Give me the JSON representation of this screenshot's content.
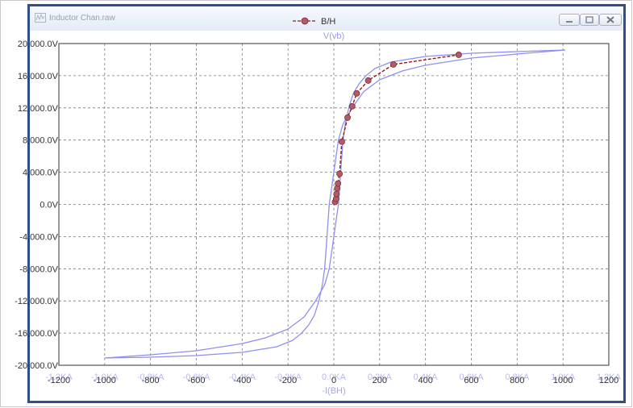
{
  "window": {
    "title": "Inductor Chan.raw",
    "icons": {
      "app": "waveform-app-icon",
      "minimize": "minimize-icon",
      "maximize": "maximize-icon",
      "close": "close-icon"
    }
  },
  "colors": {
    "hysteresis": "#8f8ff0",
    "bh": "#8b1a1a",
    "marker": "#b45a64",
    "grid": "#7a7a7a",
    "frame": "#2f4f86"
  },
  "chart_data": {
    "type": "line",
    "title": "V(vb)",
    "legend": {
      "label": "B/H",
      "placement": "top"
    },
    "xlabel": "-I(BH)",
    "xlim": [
      -1200,
      1200
    ],
    "ylim": [
      -20000,
      20000
    ],
    "grid": true,
    "x_ticks": [
      {
        "value": -1200,
        "label": "-1200"
      },
      {
        "value": -1000,
        "label": "-1000"
      },
      {
        "value": -800,
        "label": "-800"
      },
      {
        "value": -600,
        "label": "-600"
      },
      {
        "value": -400,
        "label": "-400"
      },
      {
        "value": -200,
        "label": "-200"
      },
      {
        "value": 0,
        "label": "0"
      },
      {
        "value": 200,
        "label": "200"
      },
      {
        "value": 400,
        "label": "400"
      },
      {
        "value": 600,
        "label": "600"
      },
      {
        "value": 800,
        "label": "800"
      },
      {
        "value": 1000,
        "label": "1000"
      },
      {
        "value": 1200,
        "label": "1200"
      }
    ],
    "x_ghost_ticks": [
      {
        "value": -1200,
        "label": "-1.2KA"
      },
      {
        "value": -1000,
        "label": "-1.0KA"
      },
      {
        "value": -800,
        "label": "-0.8KA"
      },
      {
        "value": -600,
        "label": "-0.6KA"
      },
      {
        "value": -400,
        "label": "-0.4KA"
      },
      {
        "value": -200,
        "label": "-0.2KA"
      },
      {
        "value": 0,
        "label": "0.0KA"
      },
      {
        "value": 200,
        "label": "0.2KA"
      },
      {
        "value": 400,
        "label": "0.4KA"
      },
      {
        "value": 600,
        "label": "0.6KA"
      },
      {
        "value": 800,
        "label": "0.8KA"
      },
      {
        "value": 1000,
        "label": "1.0KA"
      },
      {
        "value": 1200,
        "label": "1.2KA"
      }
    ],
    "y_ticks": [
      {
        "value": 20000,
        "label": "20,000.0V"
      },
      {
        "value": 16000,
        "label": "16,000.0V"
      },
      {
        "value": 12000,
        "label": "12,000.0V"
      },
      {
        "value": 8000,
        "label": "8,000.0V"
      },
      {
        "value": 4000,
        "label": "4,000.0V"
      },
      {
        "value": 0,
        "label": "0.0V"
      },
      {
        "value": -4000,
        "label": "-4,000.0V"
      },
      {
        "value": -8000,
        "label": "-8,000.0V"
      },
      {
        "value": -12000,
        "label": "-12,000.0V"
      },
      {
        "value": -16000,
        "label": "-16,000.0V"
      },
      {
        "value": -20000,
        "label": "-20,000.0V"
      }
    ],
    "series": [
      {
        "name": "V(vb)",
        "style": "solid",
        "x": [
          1010,
          800,
          600,
          400,
          250,
          180,
          140,
          110,
          85,
          65,
          50,
          40,
          35,
          30,
          25,
          20,
          10,
          0,
          -10,
          -20,
          -40,
          -80,
          -130,
          -200,
          -300,
          -400,
          -600,
          -800,
          -1000,
          -800,
          -600,
          -400,
          -250,
          -180,
          -140,
          -110,
          -85,
          -65,
          -50,
          -40,
          -35,
          -30,
          -25,
          -20,
          -10,
          0,
          10,
          20,
          40,
          80,
          130,
          200,
          300,
          400,
          600,
          800,
          1010
        ],
        "y": [
          19200,
          19000,
          18800,
          18400,
          17700,
          16900,
          16000,
          15000,
          13800,
          12000,
          10000,
          8000,
          6000,
          4000,
          2000,
          0,
          -2000,
          -4000,
          -6000,
          -8000,
          -10000,
          -12000,
          -14000,
          -15500,
          -16600,
          -17300,
          -18200,
          -18700,
          -19100,
          -19000,
          -18800,
          -18400,
          -17700,
          -16900,
          -16000,
          -15000,
          -13800,
          -12000,
          -10000,
          -8000,
          -6000,
          -4000,
          -2000,
          0,
          2000,
          4000,
          6000,
          8000,
          10000,
          12000,
          14000,
          15500,
          16600,
          17300,
          18200,
          18700,
          19200
        ]
      },
      {
        "name": "B/H",
        "style": "dashed",
        "markers": true,
        "x": [
          5,
          10,
          12,
          15,
          18,
          25,
          35,
          60,
          80,
          100,
          150,
          260,
          545
        ],
        "y": [
          300,
          700,
          1300,
          2000,
          2600,
          3800,
          7800,
          10800,
          12200,
          13800,
          15400,
          17400,
          18600
        ]
      }
    ]
  }
}
